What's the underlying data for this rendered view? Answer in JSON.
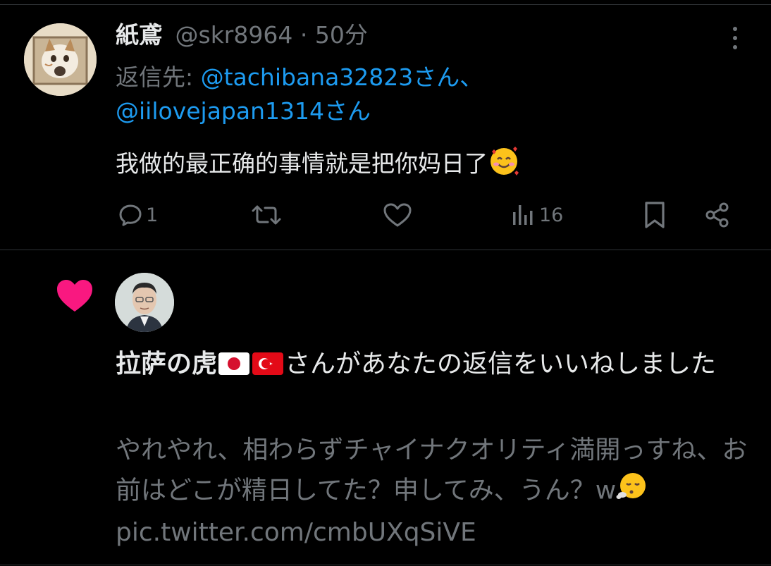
{
  "tweet": {
    "author_name": "紙鳶",
    "handle": "@skr8964",
    "separator": "·",
    "time": "50分",
    "reply_prefix": "返信先: ",
    "mention_1": "@tachibana32823さん",
    "mention_sep": "、",
    "mention_2": "@iilovejapan1314さん",
    "text": "我做的最正确的事情就是把你妈日了",
    "text_emoji": "smiling-face-with-hearts",
    "actions": {
      "reply_count": "1",
      "retweet_count": "",
      "like_count": "",
      "views_count": "16"
    }
  },
  "notification": {
    "icon": "heart",
    "icon_color": "#f91880",
    "user_name": "拉萨の虎",
    "flags": [
      "japan-flag",
      "turkey-flag"
    ],
    "message": "さんがあなたの返信をいいねしました",
    "quoted_text": "やれやれ、相わらずチャイナクオリティ満開っすね、お前はどこが精日してた？申してみ、うん？w",
    "quoted_emoji": "face-exhaling",
    "quoted_link": "pic.twitter.com/cmbUXqSiVE"
  },
  "colors": {
    "background": "#000000",
    "text_primary": "#e7e9ea",
    "text_secondary": "#71767b",
    "link": "#1d9bf0",
    "like": "#f91880",
    "divider": "#2f3336"
  }
}
